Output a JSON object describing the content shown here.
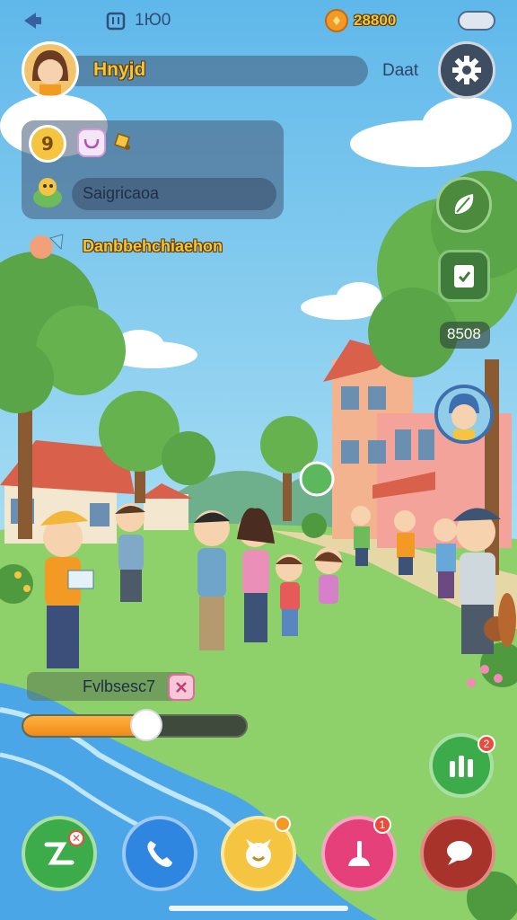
{
  "status_bar": {
    "number": "1Ю0"
  },
  "currency": {
    "amount": "28800"
  },
  "player": {
    "name": "Hnyjd",
    "side_label": "Daat"
  },
  "panel": {
    "badge_digit": "9",
    "row_label": "Saigricaoa"
  },
  "quest": {
    "text": "Danbbehchiaehon"
  },
  "right_counter": {
    "value": "8508"
  },
  "progress": {
    "label": "Fvlbsesc7",
    "fill_fraction": 0.55
  },
  "badges": {
    "stats": "2",
    "chat": "1"
  },
  "colors": {
    "sky": "#6fc3ea",
    "grass": "#8ed06a",
    "water": "#4aa6e6",
    "accent_orange": "#f39a25"
  }
}
